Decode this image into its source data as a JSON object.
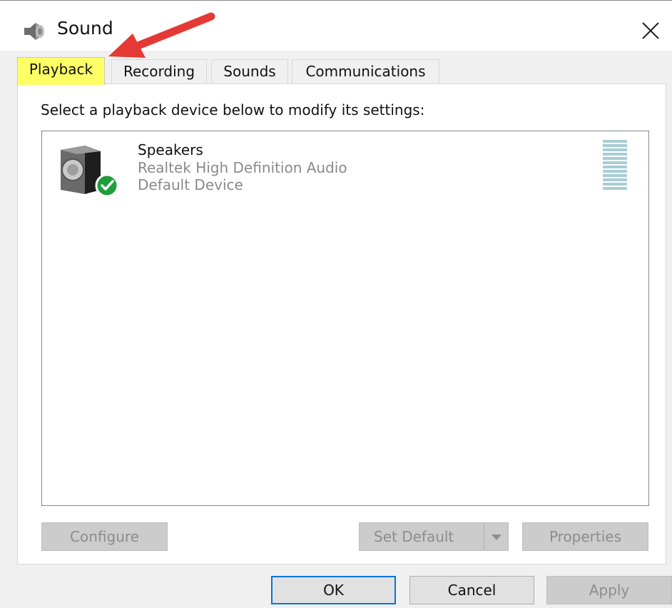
{
  "window": {
    "title": "Sound",
    "close_glyph": "✕"
  },
  "tabs": [
    {
      "label": "Playback",
      "active": true,
      "highlight_color": "#ffff66"
    },
    {
      "label": "Recording",
      "active": false
    },
    {
      "label": "Sounds",
      "active": false
    },
    {
      "label": "Communications",
      "active": false
    }
  ],
  "playback": {
    "instruction": "Select a playback device below to modify its settings:",
    "devices": [
      {
        "name": "Speakers",
        "description": "Realtek High Definition Audio",
        "status": "Default Device",
        "icon": "speaker-icon",
        "badge": "default-checkmark-icon"
      }
    ],
    "buttons": {
      "configure": "Configure",
      "set_default": "Set Default",
      "properties": "Properties"
    }
  },
  "footer": {
    "ok": "OK",
    "cancel": "Cancel",
    "apply": "Apply"
  },
  "annotation": {
    "type": "arrow",
    "color": "#e53935",
    "points_to": "Playback tab"
  }
}
